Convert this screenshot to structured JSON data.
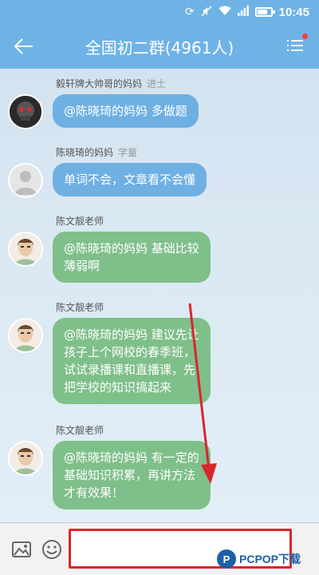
{
  "status_bar": {
    "time": "10:45"
  },
  "header": {
    "title": "全国初二群(4961人)"
  },
  "messages": [
    {
      "sender": "毅轩牌大帅哥的妈妈",
      "rank": "进士",
      "text": "@陈晓琦的妈妈 多做题",
      "style": "blue"
    },
    {
      "sender": "陈晓琦的妈妈",
      "rank": "学童",
      "text": "单词不会，文章看不会懂",
      "style": "blue"
    },
    {
      "sender": "陈文靓老师",
      "rank": "",
      "lines": [
        "@陈晓琦的妈妈 基础比较",
        "薄弱啊"
      ],
      "style": "green"
    },
    {
      "sender": "陈文靓老师",
      "rank": "",
      "lines": [
        "@陈晓琦的妈妈 建议先让",
        "孩子上个网校的春季班，",
        "试试录播课和直播课，先",
        "把学校的知识搞起来"
      ],
      "style": "green"
    },
    {
      "sender": "陈文靓老师",
      "rank": "",
      "lines": [
        "@陈晓琦的妈妈 有一定的",
        "基础知识积累，再讲方法",
        "才有效果！"
      ],
      "style": "green"
    }
  ],
  "input": {
    "value": "",
    "placeholder": ""
  },
  "watermark": {
    "text": "PCPOP下载"
  },
  "colors": {
    "header": "#6fb3e6",
    "bubble_blue": "#6fb0e3",
    "bubble_green": "#7fbf8a",
    "highlight": "#d9262c"
  }
}
